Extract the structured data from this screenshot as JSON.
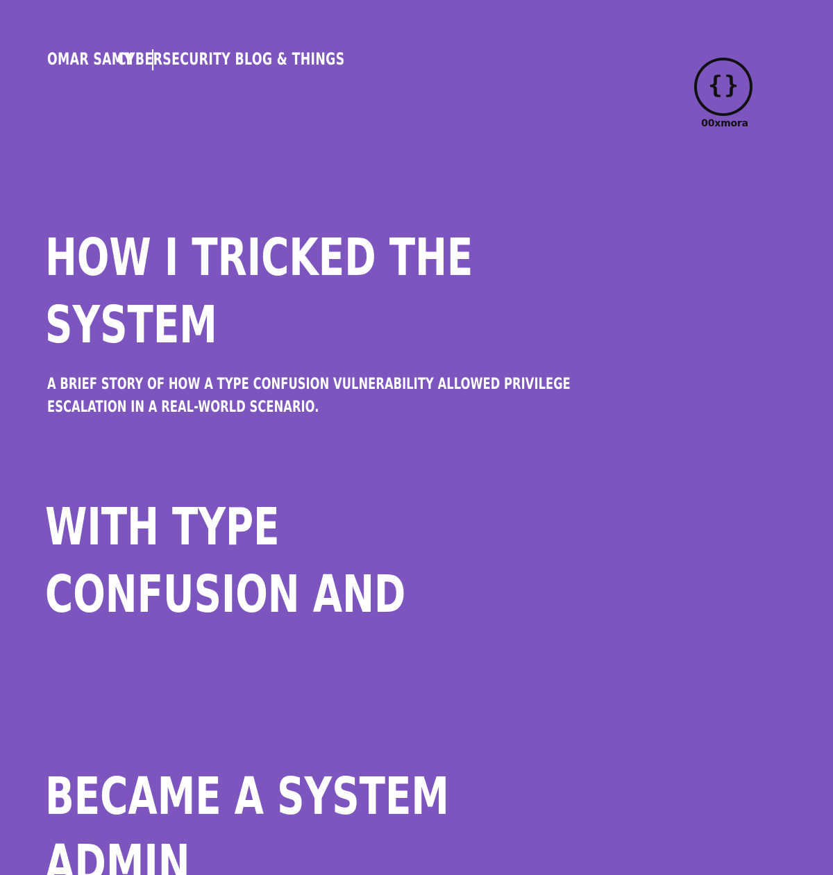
{
  "colors": {
    "background": "#7c55bf",
    "text": "#ffffff",
    "logo": "#111111"
  },
  "header": {
    "author": "OMAR SAMY",
    "separator": "|",
    "site": "CYBERSECURITY BLOG & THINGS"
  },
  "post": {
    "title_lines": [
      "HOW I TRICKED THE SYSTEM",
      "WITH TYPE CONFUSION AND",
      "BECAME A SYSTEM ADMIN"
    ],
    "subtitle": "A BRIEF STORY OF HOW A TYPE CONFUSION VULNERABILITY ALLOWED PRIVILEGE ESCALATION IN A REAL-WORLD SCENARIO."
  },
  "logo": {
    "icon": "curly-braces-icon",
    "left_brace": "{",
    "right_brace": "}",
    "name": "00xmora"
  }
}
